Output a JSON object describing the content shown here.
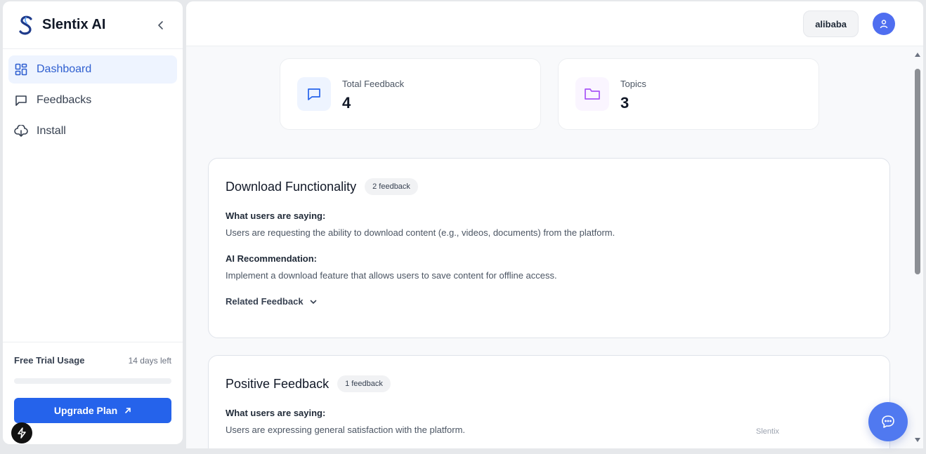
{
  "app": {
    "name": "Slentix AI"
  },
  "sidebar": {
    "items": [
      {
        "label": "Dashboard",
        "icon": "dashboard-grid-icon",
        "active": true
      },
      {
        "label": "Feedbacks",
        "icon": "message-square-icon",
        "active": false
      },
      {
        "label": "Install",
        "icon": "cloud-download-icon",
        "active": false
      }
    ],
    "trial": {
      "title": "Free Trial Usage",
      "days_left": "14 days left",
      "usage_fraction": 0
    },
    "upgrade_label": "Upgrade Plan"
  },
  "header": {
    "org": "alibaba"
  },
  "stats": [
    {
      "label": "Total Feedback",
      "value": "4",
      "icon": "message-square-icon",
      "color": "#2563eb"
    },
    {
      "label": "Topics",
      "value": "3",
      "icon": "folder-icon",
      "color": "#a855f7"
    }
  ],
  "topics": [
    {
      "title": "Download Functionality",
      "badge": "2 feedback",
      "saying_label": "What users are saying:",
      "saying": "Users are requesting the ability to download content (e.g., videos, documents) from the platform.",
      "rec_label": "AI Recommendation:",
      "rec": "Implement a download feature that allows users to save content for offline access.",
      "related_label": "Related Feedback"
    },
    {
      "title": "Positive Feedback",
      "badge": "1 feedback",
      "saying_label": "What users are saying:",
      "saying": "Users are expressing general satisfaction with the platform."
    }
  ],
  "watermark": "Slentix",
  "colors": {
    "primary": "#2563eb",
    "active_bg": "#eef4ff",
    "chat_fab": "#5079f0"
  }
}
